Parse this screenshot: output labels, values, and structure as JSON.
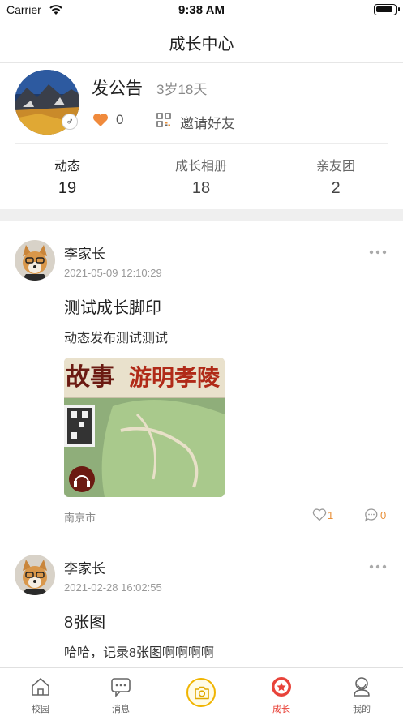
{
  "status_bar": {
    "carrier": "Carrier",
    "time": "9:38 AM"
  },
  "nav": {
    "title": "成长中心"
  },
  "profile": {
    "name": "发公告",
    "age": "3岁18天",
    "gender_symbol": "♂",
    "likes": "0",
    "invite_label": "邀请好友",
    "stats": [
      {
        "label": "动态",
        "value": "19"
      },
      {
        "label": "成长相册",
        "value": "18"
      },
      {
        "label": "亲友团",
        "value": "2"
      }
    ]
  },
  "posts": [
    {
      "author": "李家长",
      "time": "2021-05-09 12:10:29",
      "title": "测试成长脚印",
      "body": "动态发布测试测试",
      "location": "南京市",
      "likes": "1",
      "comments": "0",
      "photo_text_1": "故事",
      "photo_text_2": "游明孝陵"
    },
    {
      "author": "李家长",
      "time": "2021-02-28 16:02:55",
      "title": "8张图",
      "body": "哈哈，记录8张图啊啊啊啊"
    }
  ],
  "tabs": [
    {
      "label": "校园",
      "icon": "home-icon"
    },
    {
      "label": "消息",
      "icon": "message-icon"
    },
    {
      "label": "",
      "icon": "camera-icon"
    },
    {
      "label": "成长",
      "icon": "star-icon"
    },
    {
      "label": "我的",
      "icon": "user-icon"
    }
  ],
  "colors": {
    "accent": "#e8433a",
    "like": "#e8903a",
    "heart": "#f08a3c",
    "camera": "#f0b400"
  }
}
